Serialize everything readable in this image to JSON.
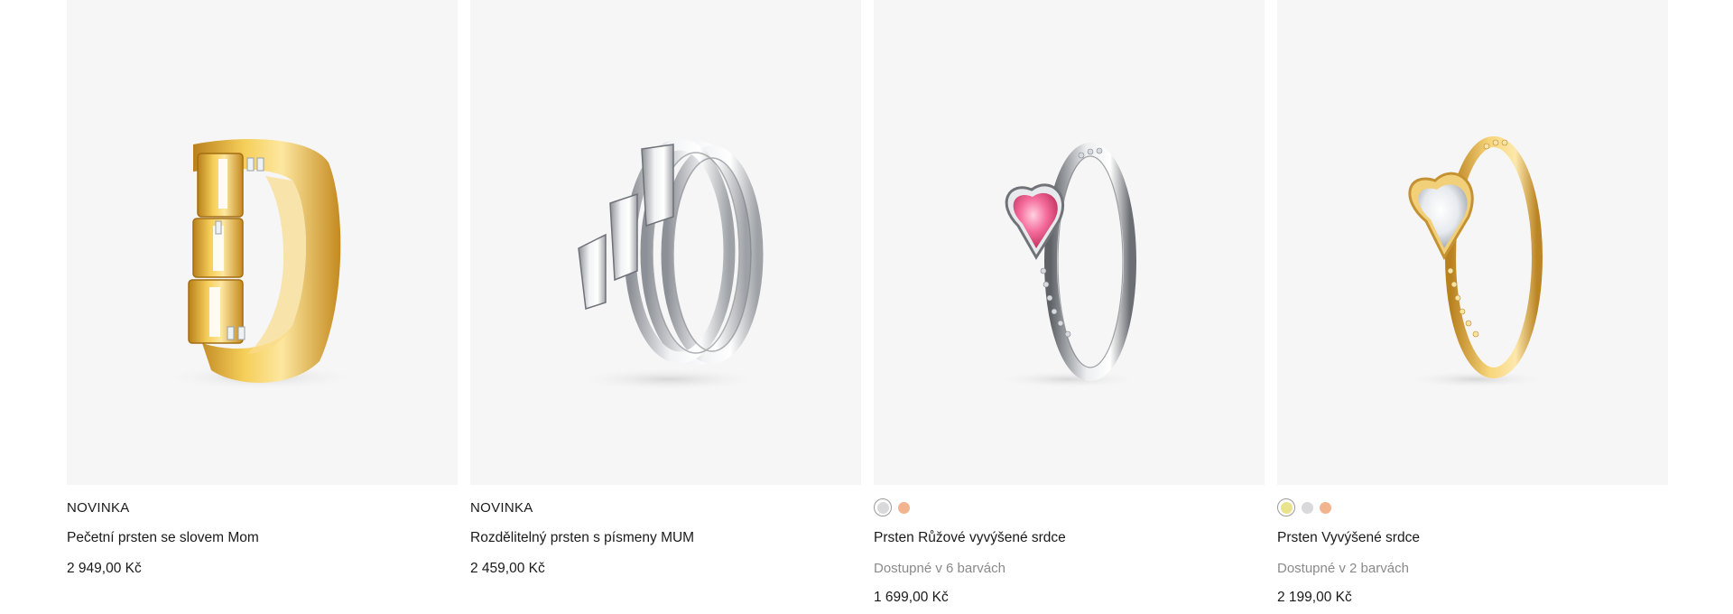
{
  "products": [
    {
      "badge": "NOVINKA",
      "name": "Pečetní prsten se slovem Mom",
      "price": "2 949,00 Kč",
      "image_icon": "gold-mom-ring-image"
    },
    {
      "badge": "NOVINKA",
      "name": "Rozdělitelný prsten s písmeny MUM",
      "price": "2 459,00 Kč",
      "image_icon": "silver-mum-ring-image"
    },
    {
      "swatches": [
        "#d9d9db",
        "#f2b48f"
      ],
      "selected_swatch": 0,
      "name": "Prsten Růžové vyvýšené srdce",
      "colors_text": "Dostupné v 6 barvách",
      "price": "1 699,00 Kč",
      "image_icon": "pink-heart-ring-image"
    },
    {
      "swatches": [
        "#e9e48c",
        "#d9d9db",
        "#f2b48f"
      ],
      "selected_swatch": 0,
      "name": "Prsten Vyvýšené srdce",
      "colors_text": "Dostupné v 2 barvách",
      "price": "2 199,00 Kč",
      "image_icon": "gold-heart-ring-image"
    }
  ],
  "colors": {
    "image_bg": "#f6f6f6",
    "muted_text": "#8a8a8a",
    "gold": "#e6b23a",
    "silver": "#d4d6d9",
    "pink_stone": "#f06a9a"
  }
}
